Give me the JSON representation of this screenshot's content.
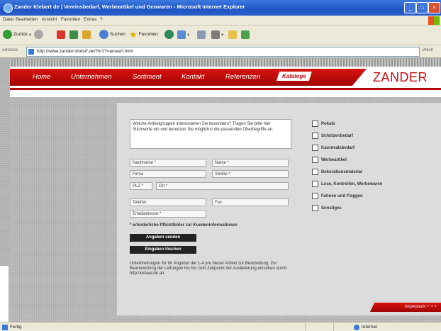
{
  "window": {
    "title": "Zander Klebert de | Vereinsbedarf, Werbeartikel und Geowaren - Microsoft Internet Explorer"
  },
  "menu": [
    "Datei",
    "Bearbeiten",
    "Ansicht",
    "Favoriten",
    "Extras",
    "?"
  ],
  "toolbar": {
    "back": "Zurück",
    "search": "Suchen",
    "favorites": "Favoriten"
  },
  "address": {
    "label": "Adresse",
    "url": "http://www.zander-shdsrf.de/?m1?=anwert.html",
    "go": "Wech"
  },
  "nav": {
    "items": [
      "Home",
      "Unternehmen",
      "Sortiment",
      "Kontakt",
      "Referenzen"
    ],
    "active": "Kataloge",
    "logo": "ZANDER"
  },
  "form": {
    "question": "Welche Artikelgruppen interessieren Sie besonders? Tragen Sie bitte hier Stichworte ein und benutzen Sie möglichst die passenden Oberbegriffe an.",
    "fields": {
      "lastname": "Nachname *",
      "firstname": "Name *",
      "company": "Firma",
      "street": "Straße *",
      "zip": "PLZ *",
      "city": "Ort *",
      "phone": "Telefon",
      "fax": "Fax",
      "email": "Emailadresse *"
    },
    "required_note": "* erforderliche Pflichtfelder zur Kundeninformationen",
    "send": "Angaben senden",
    "reset": "Eingaben löschen",
    "footnote": "Unterbreitungen für Ihr Angebot der 1-4 pro Neuer Artikel zur Bearbeitung. Zur Beantwortung der Leitungen bis hin zum Zeitpunkt der Auslieferung einsehen durch http://erbaal.de an."
  },
  "categories": [
    "Pokale",
    "Schützenbedarf",
    "Karnevalsbedarf",
    "Werbeartikel",
    "Dekorationsmaterial",
    "Lose, Kontrollen, Werbewaren",
    "Fahnen und Flaggen",
    "Sonstiges"
  ],
  "footer": {
    "label": "Impressum + + +"
  },
  "status": {
    "text": "Fertig",
    "zone": "Internet"
  },
  "colors": {
    "brand_red": "#c40d0d",
    "titlebar_blue": "#1f54c4"
  }
}
